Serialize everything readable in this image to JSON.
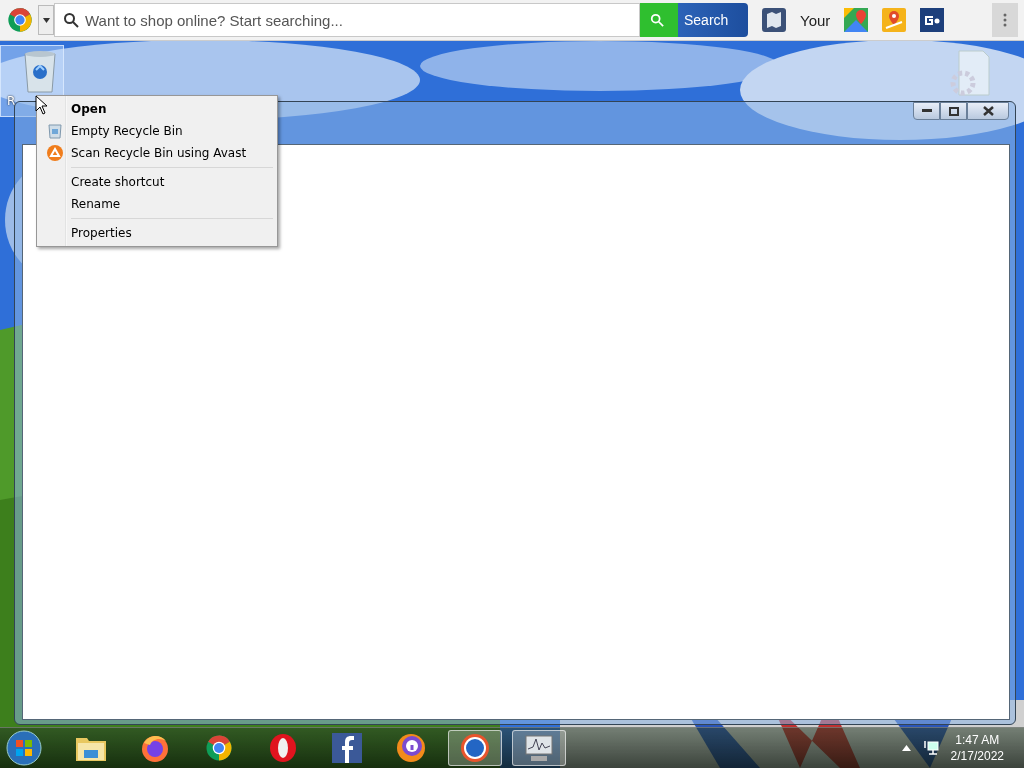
{
  "toolbar": {
    "search": {
      "placeholder": "Want to shop online? Start searching..."
    },
    "search_button": "Search",
    "bookmarks": [
      {
        "kind": "map"
      },
      {
        "kind": "text",
        "label": "Your"
      },
      {
        "kind": "gmaps"
      },
      {
        "kind": "pin"
      },
      {
        "kind": "badge"
      }
    ]
  },
  "desktop_icons": [
    {
      "kind": "recycle-bin",
      "label": "R",
      "selected": true
    },
    {
      "kind": "settings-file",
      "selected": false
    }
  ],
  "window": {
    "buttons": [
      {
        "kind": "minimize"
      },
      {
        "kind": "maximize"
      },
      {
        "kind": "close"
      }
    ]
  },
  "context_menu": {
    "items": [
      {
        "kind": "item",
        "label": "Open",
        "default": true
      },
      {
        "kind": "item",
        "label": "Empty Recycle Bin",
        "default": false
      },
      {
        "kind": "item",
        "label": "Scan Recycle Bin using Avast",
        "default": false
      },
      {
        "kind": "separator"
      },
      {
        "kind": "item",
        "label": "Create shortcut",
        "default": false
      },
      {
        "kind": "item",
        "label": "Rename",
        "default": false
      },
      {
        "kind": "separator"
      },
      {
        "kind": "item",
        "label": "Properties",
        "default": false
      }
    ]
  },
  "taskbar": {
    "apps": [
      {
        "kind": "folder",
        "open": false
      },
      {
        "kind": "firefox",
        "open": false
      },
      {
        "kind": "chrome",
        "open": false
      },
      {
        "kind": "opera",
        "open": false
      },
      {
        "kind": "facebook",
        "open": false
      },
      {
        "kind": "secure-browser",
        "open": false
      },
      {
        "kind": "ur",
        "open": true
      },
      {
        "kind": "monitor",
        "open": true
      }
    ],
    "clock": {
      "time": "1:47 AM",
      "date": "2/17/2022"
    }
  }
}
